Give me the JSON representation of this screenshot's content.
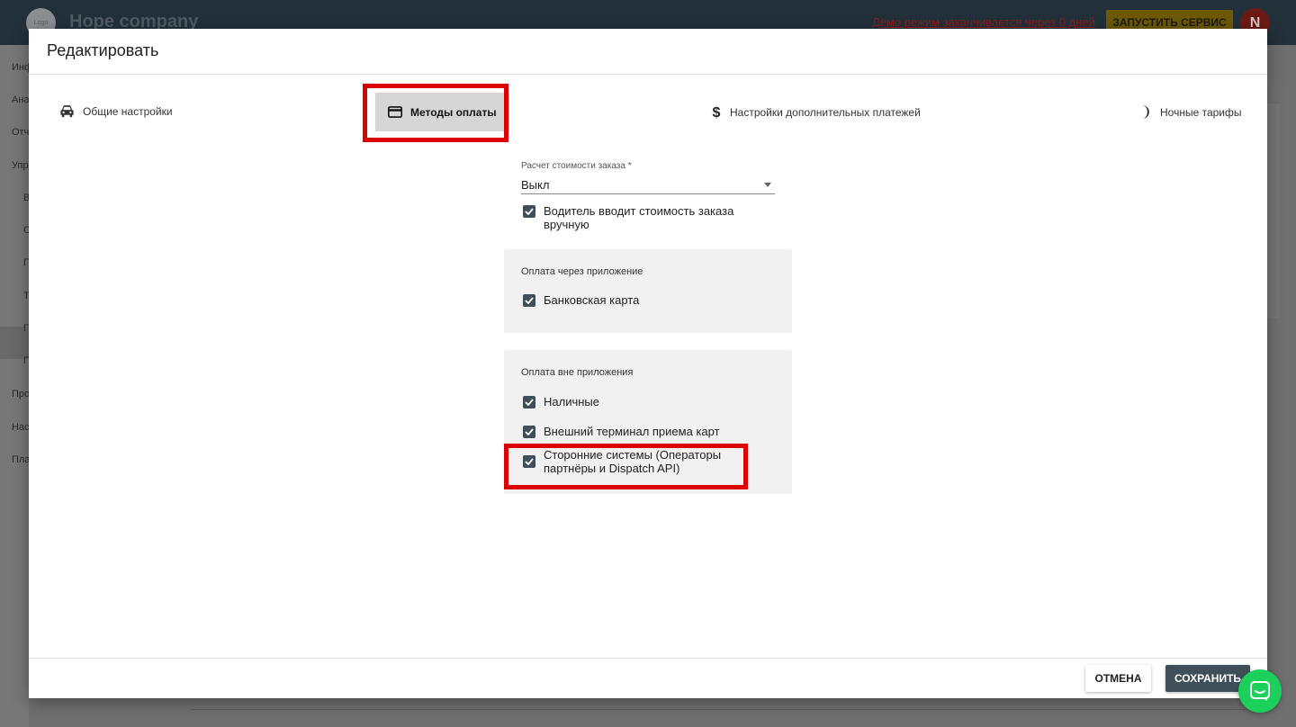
{
  "app": {
    "logo_text": "Logo",
    "company_name": "Hope company",
    "demo_notice": "Демо режим заканчивается через 0 дней",
    "run_service_label": "ЗАПУСТИТЬ СЕРВИС",
    "user_initial": "N"
  },
  "sidebar": {
    "items": [
      "Инф",
      "Ана",
      "Отч",
      "Упр",
      "В",
      "О",
      "П",
      "Т",
      "П",
      "П",
      "Про",
      "Нас",
      "Пла"
    ]
  },
  "modal": {
    "title": "Редактировать",
    "tabs": [
      {
        "label": "Общие настройки",
        "icon": "car-icon"
      },
      {
        "label": "Методы оплаты",
        "icon": "credit-card-icon"
      },
      {
        "label": "Настройки дополнительных платежей",
        "icon": "dollar-icon"
      },
      {
        "label": "Ночные тарифы",
        "icon": "moon-icon"
      }
    ],
    "pricing": {
      "label": "Расчет стоимости заказа *",
      "value": "Выкл"
    },
    "manual_price_check": "Водитель вводит стоимость заказа вручную",
    "in_app": {
      "title": "Оплата через приложение",
      "options": [
        "Банковская карта"
      ]
    },
    "out_app": {
      "title": "Оплата вне приложения",
      "options": [
        "Наличные",
        "Внешний терминал приема карт",
        "Сторонние системы (Операторы партнёры и Dispatch API)"
      ]
    },
    "cancel_label": "ОТМЕНА",
    "save_label": "СОХРАНИТЬ"
  },
  "colors": {
    "accent": "#3f4f5a",
    "highlight": "#dd0000",
    "chat": "#1bd05b"
  }
}
